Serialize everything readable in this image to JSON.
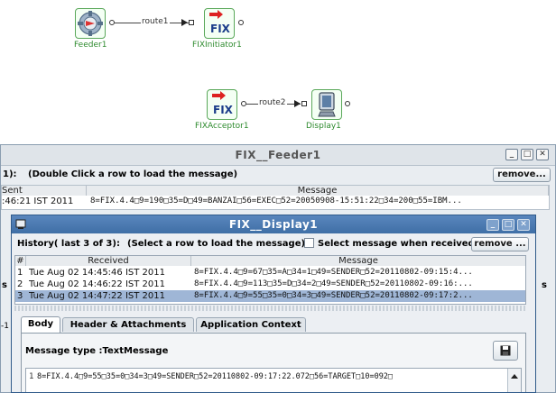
{
  "diagram": {
    "nodes": [
      {
        "label": "Feeder1",
        "icon": "gear-icon"
      },
      {
        "label": "FIXInitiator1",
        "icon": "fix-icon"
      },
      {
        "label": "FIXAcceptor1",
        "icon": "fix-icon"
      },
      {
        "label": "Display1",
        "icon": "monitor-icon"
      }
    ],
    "routes": [
      "route1",
      "route2"
    ],
    "fix_text": "FIX"
  },
  "feeder_window": {
    "title": "FIX__Feeder1",
    "history_label": "1):",
    "instruction": "(Double Click a row to load the message)",
    "remove_label": "remove...",
    "col_sent": "Sent",
    "col_message": "Message",
    "row": {
      "received": ":46:21 IST 2011",
      "message": "8=FIX.4.4□9=190□35=D□49=BANZAI□56=EXEC□52=20050908-15:51:22□34=200□55=IBM..."
    }
  },
  "display_window": {
    "title": "FIX__Display1",
    "history_label": "History( last 3 of 3):",
    "instruction": "(Select a row to load the message)",
    "checkbox_label": "Select message when received",
    "remove_label": "remove ...",
    "columns": [
      "#",
      "Received",
      "Message"
    ],
    "rows": [
      {
        "num": "1",
        "received": "Tue Aug 02 14:45:46 IST 2011",
        "message": "8=FIX.4.4□9=67□35=A□34=1□49=SENDER□52=20110802-09:15:4..."
      },
      {
        "num": "2",
        "received": "Tue Aug 02 14:46:22 IST 2011",
        "message": "8=FIX.4.4□9=113□35=D□34=2□49=SENDER□52=20110802-09:16:..."
      },
      {
        "num": "3",
        "received": "Tue Aug 02 14:47:22 IST 2011",
        "message": "8=FIX.4.4□9=55□35=0□34=3□49=SENDER□52=20110802-09:17:2..."
      }
    ],
    "tabs": [
      "Body",
      "Header & Attachments",
      "Application Context"
    ],
    "message_type": "Message type :TextMessage",
    "body_line_number": "1",
    "body_text": "8=FIX.4.4□9=55□35=0□34=3□49=SENDER□52=20110802-09:17:22.072□56=TARGET□10=092□"
  },
  "left_fragments": [
    "s",
    "-1"
  ],
  "right_fragment": "s",
  "colors": {
    "node_border": "#5aa85a",
    "node_label": "#2e8b2e",
    "feeder_titlebar": "#dfe4e9",
    "display_titlebar": "#3f6fa6",
    "selected_row": "#9fb6d6"
  }
}
